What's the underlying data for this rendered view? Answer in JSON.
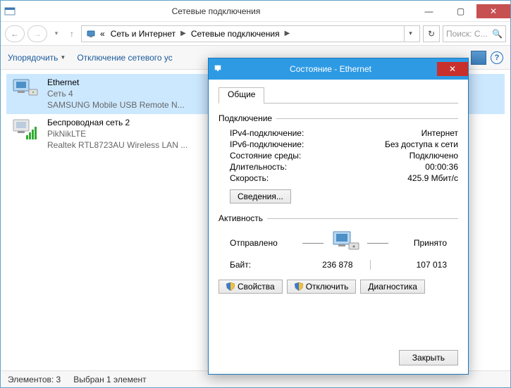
{
  "window": {
    "title": "Сетевые подключения"
  },
  "breadcrumb": {
    "prefix": "«",
    "items": [
      "Сеть и Интернет",
      "Сетевые подключения"
    ]
  },
  "search": {
    "placeholder": "Поиск: С..."
  },
  "toolbar": {
    "organize": "Упорядочить",
    "action1_truncated": "Отключение сетевого ус"
  },
  "connections": [
    {
      "name": "Ethernet",
      "line2": "Сеть  4",
      "line3": "SAMSUNG Mobile USB Remote N..."
    },
    {
      "name": "Беспроводная сеть 2",
      "line2": "PikNikLTE",
      "line3": "Realtek RTL8723AU Wireless LAN ..."
    }
  ],
  "statusbar": {
    "items_label": "Элементов: 3",
    "selected_label": "Выбран 1 элемент"
  },
  "dialog": {
    "title": "Состояние - Ethernet",
    "tab": "Общие",
    "sections": {
      "connection": {
        "label": "Подключение",
        "rows": [
          {
            "k": "IPv4-подключение:",
            "v": "Интернет"
          },
          {
            "k": "IPv6-подключение:",
            "v": "Без доступа к сети"
          },
          {
            "k": "Состояние среды:",
            "v": "Подключено"
          },
          {
            "k": "Длительность:",
            "v": "00:00:36"
          },
          {
            "k": "Скорость:",
            "v": "425.9 Мбит/с"
          }
        ],
        "details_btn": "Сведения..."
      },
      "activity": {
        "label": "Активность",
        "sent": "Отправлено",
        "received": "Принято",
        "bytes_label": "Байт:",
        "sent_bytes": "236 878",
        "recv_bytes": "107 013"
      }
    },
    "buttons": {
      "properties": "Свойства",
      "disable": "Отключить",
      "diagnose": "Диагностика",
      "close": "Закрыть"
    }
  }
}
